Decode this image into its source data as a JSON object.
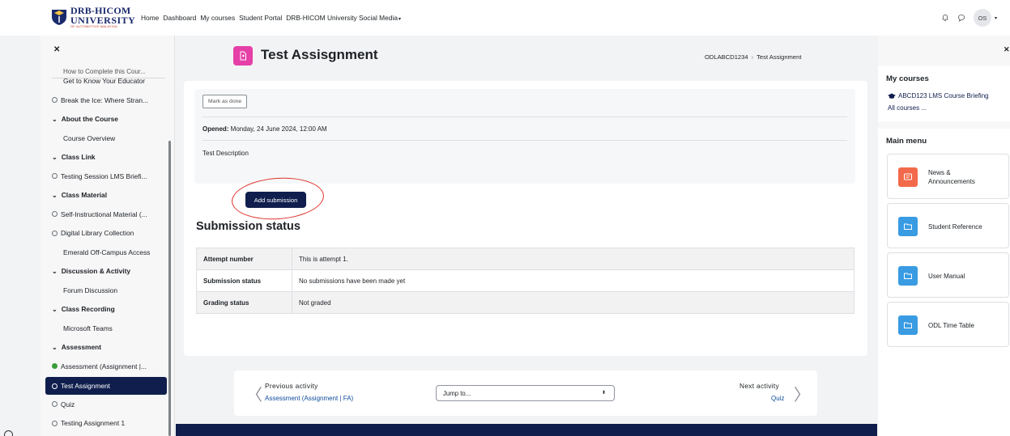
{
  "navbar": {
    "logo_line1": "DRB-HICOM",
    "logo_line2": "UNIVERSITY",
    "logo_line3": "OF AUTOMOTIVE MALAYSIA",
    "links": [
      "Home",
      "Dashboard",
      "My courses",
      "Student Portal",
      "DRB-HICOM University Social Media"
    ],
    "avatar_initials": "OS"
  },
  "course_index": {
    "cut_item": "How to Complete this Cour...",
    "items": [
      {
        "label": "Get to Know Your Educator",
        "kind": "plain"
      },
      {
        "label": "Break the Ice: Where Stran...",
        "kind": "activity"
      },
      {
        "label": "About the Course",
        "kind": "section"
      },
      {
        "label": "Course Overview",
        "kind": "plain"
      },
      {
        "label": "Class Link",
        "kind": "section"
      },
      {
        "label": "Testing Session LMS Briefi...",
        "kind": "activity"
      },
      {
        "label": "Class Material",
        "kind": "section"
      },
      {
        "label": "Self-Instructional Material (...",
        "kind": "activity"
      },
      {
        "label": "Digital Library Collection",
        "kind": "activity"
      },
      {
        "label": "Emerald Off-Campus Access",
        "kind": "plain"
      },
      {
        "label": "Discussion & Activity",
        "kind": "section"
      },
      {
        "label": "Forum Discussion",
        "kind": "plain"
      },
      {
        "label": "Class Recording",
        "kind": "section"
      },
      {
        "label": "Microsoft Teams",
        "kind": "plain"
      },
      {
        "label": "Assessment",
        "kind": "section"
      },
      {
        "label": "Assessment (Assignment |...",
        "kind": "done"
      },
      {
        "label": "Test Assignment",
        "kind": "active"
      },
      {
        "label": "Quiz",
        "kind": "activity"
      },
      {
        "label": "Testing Assignment 1",
        "kind": "activity"
      }
    ]
  },
  "page": {
    "title": "Test Assisgnment",
    "breadcrumb": [
      "ODLABCD1234",
      "Test Assignment"
    ],
    "mark_done": "Mark as done",
    "opened_label": "Opened:",
    "opened_value": " Monday, 24 June 2024, 12:00 AM",
    "description": "Test Description",
    "add_submission": "Add submission",
    "submission_heading": "Submission status",
    "status_rows": [
      {
        "key": "Attempt number",
        "value": "This is attempt 1."
      },
      {
        "key": "Submission status",
        "value": "No submissions have been made yet"
      },
      {
        "key": "Grading status",
        "value": "Not graded"
      }
    ]
  },
  "activity_nav": {
    "prev_label": "Previous activity",
    "prev_link": "Assessment (Assignment | FA)",
    "jump_placeholder": "Jump to...",
    "next_label": "Next activity",
    "next_link": "Quiz"
  },
  "right_drawer": {
    "my_courses_title": "My courses",
    "course_link": "ABCD123 LMS Course Briefing",
    "all_courses": "All courses ...",
    "main_menu_title": "Main menu",
    "menu_items": [
      {
        "label": "News & Announcements",
        "color": "#f26a4b",
        "icon": "forum-icon"
      },
      {
        "label": "Student Reference",
        "color": "#399be2",
        "icon": "folder-icon"
      },
      {
        "label": "User Manual",
        "color": "#399be2",
        "icon": "folder-icon"
      },
      {
        "label": "ODL Time Table",
        "color": "#399be2",
        "icon": "folder-icon"
      }
    ]
  }
}
